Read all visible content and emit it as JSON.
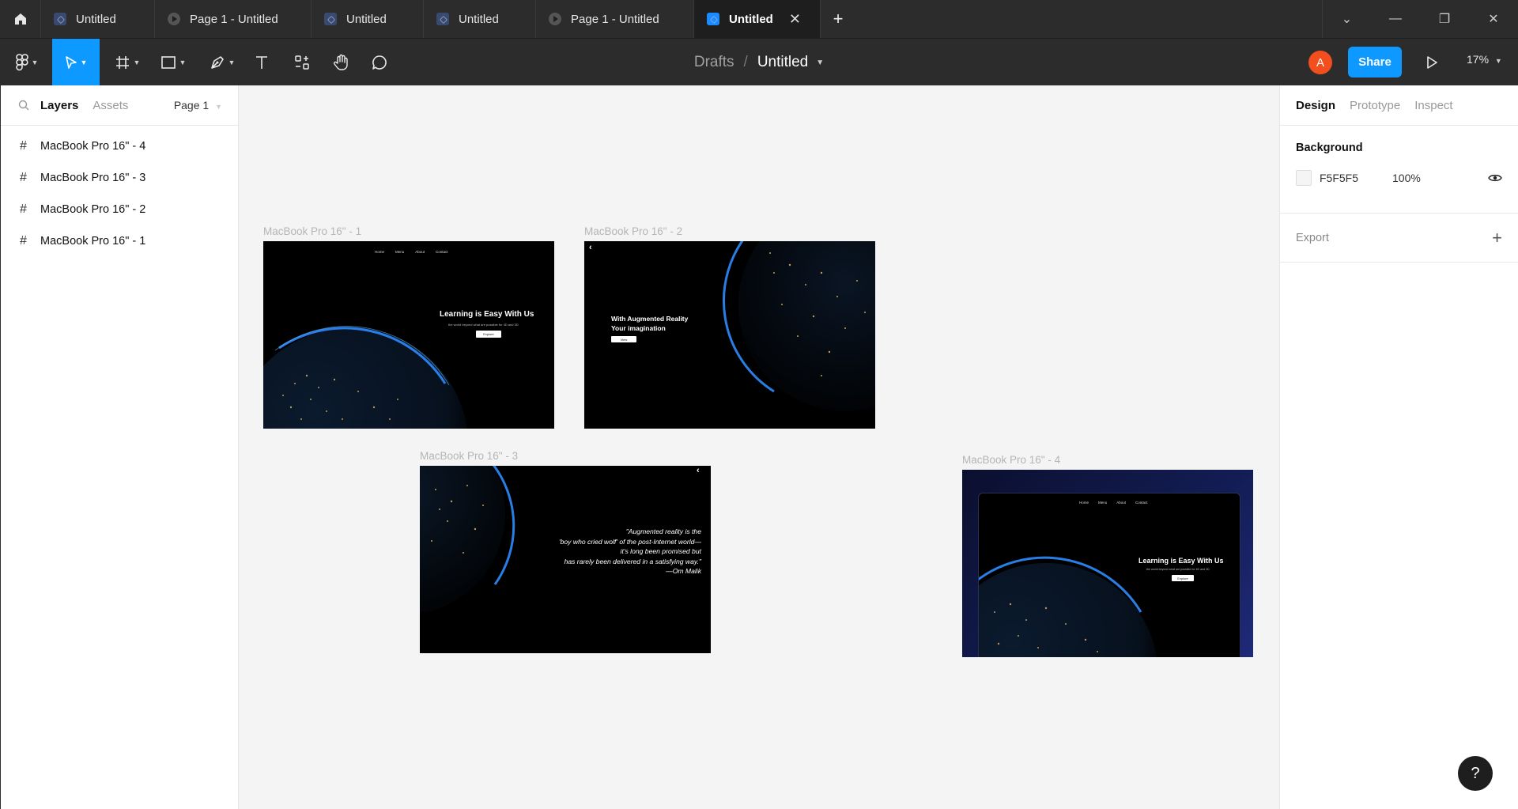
{
  "tabs": [
    {
      "label": "Untitled",
      "kind": "file"
    },
    {
      "label": "Page 1 - Untitled",
      "kind": "prototype"
    },
    {
      "label": "Untitled",
      "kind": "file"
    },
    {
      "label": "Untitled",
      "kind": "file"
    },
    {
      "label": "Page 1 - Untitled",
      "kind": "prototype"
    },
    {
      "label": "Untitled",
      "kind": "file",
      "active": true
    }
  ],
  "breadcrumb": {
    "folder": "Drafts",
    "separator": "/",
    "file": "Untitled"
  },
  "toolbar": {
    "avatar_initial": "A",
    "share_label": "Share",
    "zoom": "17%"
  },
  "left_panel": {
    "tab_layers": "Layers",
    "tab_assets": "Assets",
    "page_selector": "Page 1",
    "layers": [
      "MacBook Pro 16\" - 4",
      "MacBook Pro 16\" - 3",
      "MacBook Pro 16\" - 2",
      "MacBook Pro 16\" - 1"
    ]
  },
  "frames": {
    "f1": {
      "label": "MacBook Pro 16\" - 1",
      "nav": [
        "Home",
        "Menu",
        "About",
        "Contact"
      ],
      "title": "Learning is Easy With Us",
      "subtitle": "the world beyond what are possible for 4D and 3D",
      "button": "Explore"
    },
    "f2": {
      "label": "MacBook Pro 16\" - 2",
      "title_line1": "With Augmented Reality",
      "title_line2": "Your imagination",
      "button": "View"
    },
    "f3": {
      "label": "MacBook Pro 16\" - 3",
      "quote": [
        "\"Augmented reality is the",
        "'boy who cried wolf' of the post-Internet world—",
        "it's long been promised but",
        "has rarely been delivered in a satisfying way.\"",
        "—Om Malik"
      ]
    },
    "f4": {
      "label": "MacBook Pro 16\" - 4",
      "nav": [
        "Home",
        "Menu",
        "About",
        "Contact"
      ],
      "title": "Learning is Easy With Us",
      "subtitle": "the world beyond what are possible for 4D and 3D",
      "button": "Explore"
    }
  },
  "right_panel": {
    "tabs": [
      "Design",
      "Prototype",
      "Inspect"
    ],
    "background_title": "Background",
    "background_hex": "F5F5F5",
    "background_opacity": "100%",
    "export_title": "Export"
  },
  "help_label": "?",
  "colors": {
    "accent": "#0d99ff",
    "avatar": "#f24e1e",
    "canvas": "#f4f4f4",
    "chrome": "#2c2c2c"
  }
}
